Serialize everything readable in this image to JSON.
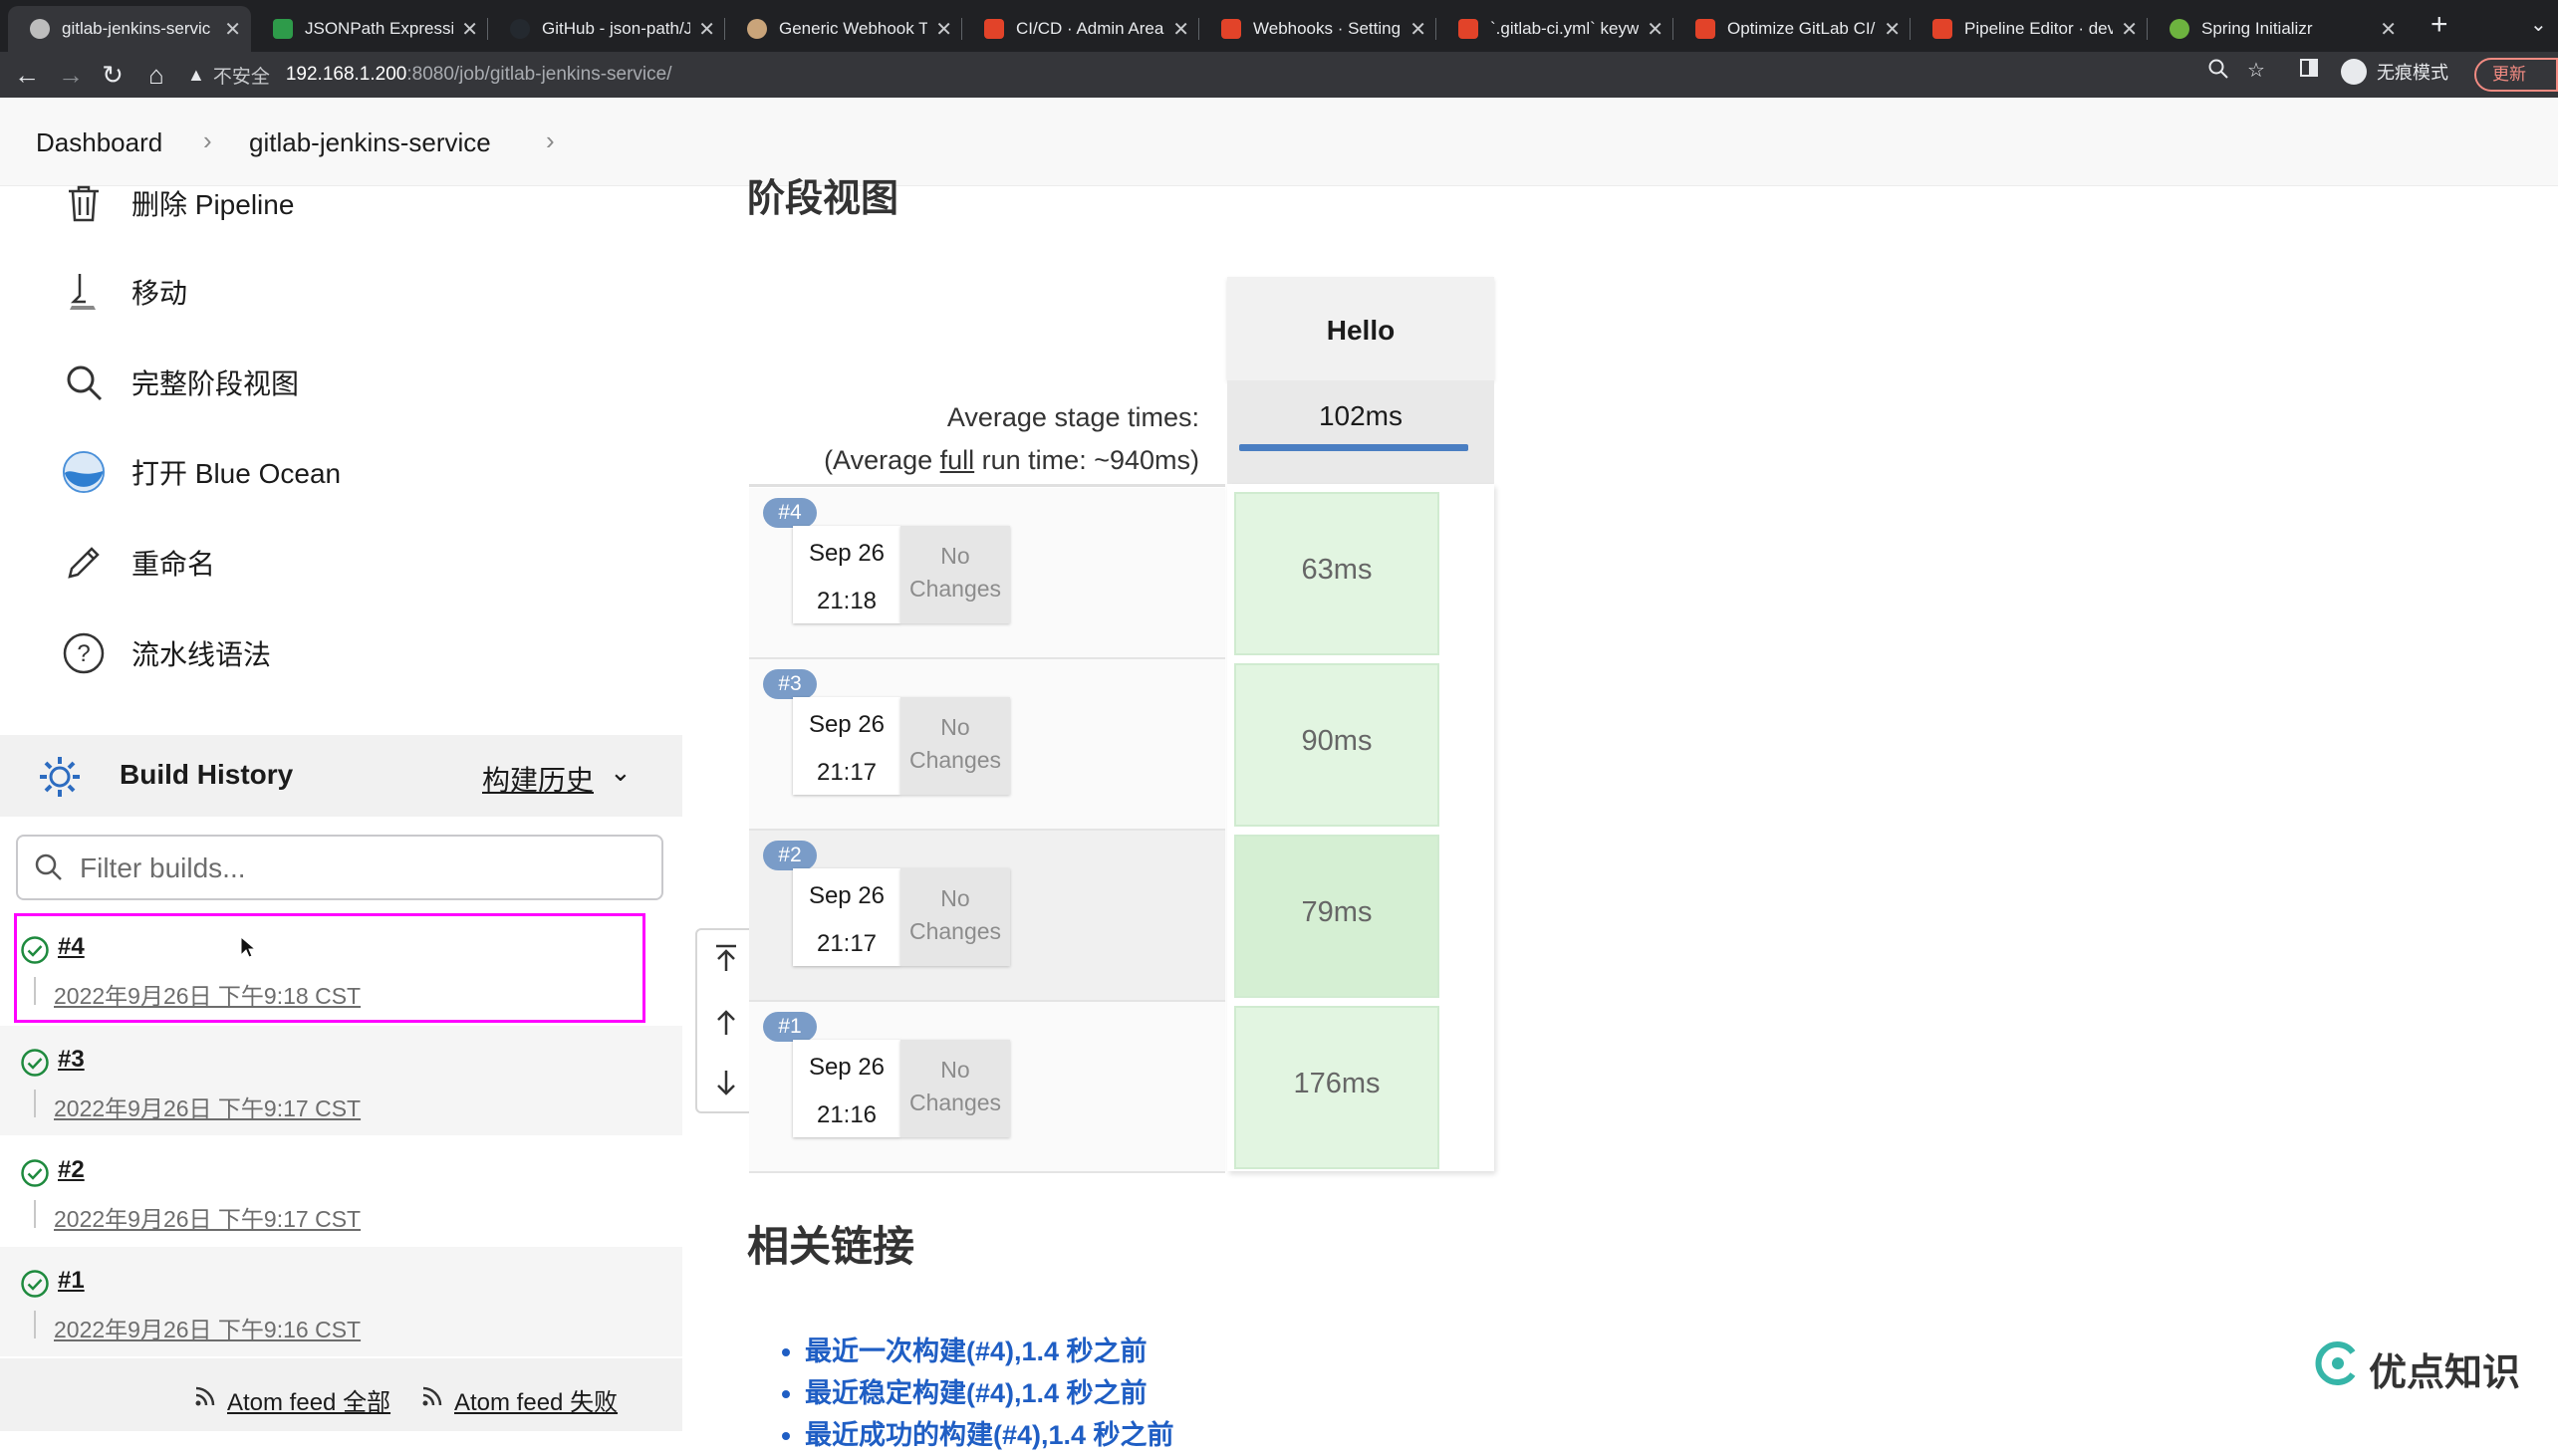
{
  "browser": {
    "tabs": [
      {
        "label": "gitlab-jenkins-servic",
        "icon_color": "#bdbdbd",
        "active": true
      },
      {
        "label": "JSONPath Expressic",
        "icon_color": "#2e9b4a"
      },
      {
        "label": "GitHub - json-path/J",
        "icon_color": "#24292f"
      },
      {
        "label": "Generic Webhook Tr",
        "icon_color": "#c9a47a"
      },
      {
        "label": "CI/CD · Admin Area",
        "icon_color": "#e24329"
      },
      {
        "label": "Webhooks · Setting",
        "icon_color": "#e24329"
      },
      {
        "label": "`.gitlab-ci.yml` keyw",
        "icon_color": "#e24329"
      },
      {
        "label": "Optimize GitLab CI/C",
        "icon_color": "#e24329"
      },
      {
        "label": "Pipeline Editor · dev",
        "icon_color": "#e24329"
      },
      {
        "label": "Spring Initializr",
        "icon_color": "#6db33f"
      }
    ],
    "new_tab": "+",
    "insecure_label": "不安全",
    "url_host": "192.168.1.200",
    "url_path": ":8080/job/gitlab-jenkins-service/",
    "incognito_label": "无痕模式",
    "update_label": "更新"
  },
  "breadcrumbs": {
    "home": "Dashboard",
    "job": "gitlab-jenkins-service"
  },
  "sidebar": {
    "items": [
      {
        "label": "删除 Pipeline",
        "icon": "trash-icon"
      },
      {
        "label": "移动",
        "icon": "move-icon"
      },
      {
        "label": "完整阶段视图",
        "icon": "search-icon"
      },
      {
        "label": "打开 Blue Ocean",
        "icon": "blue-ocean-icon"
      },
      {
        "label": "重命名",
        "icon": "pencil-icon"
      },
      {
        "label": "流水线语法",
        "icon": "help-icon"
      }
    ],
    "build_history": {
      "title": "Build History",
      "trend_label": "构建历史"
    },
    "filter_placeholder": "Filter builds...",
    "builds": [
      {
        "number": "#4",
        "date": "2022年9月26日 下午9:18 CST",
        "status": "success"
      },
      {
        "number": "#3",
        "date": "2022年9月26日 下午9:17 CST",
        "status": "success"
      },
      {
        "number": "#2",
        "date": "2022年9月26日 下午9:17 CST",
        "status": "success"
      },
      {
        "number": "#1",
        "date": "2022年9月26日 下午9:16 CST",
        "status": "success"
      }
    ],
    "feeds": {
      "all": "Atom feed 全部",
      "failed": "Atom feed 失败"
    }
  },
  "stage_view": {
    "title": "阶段视图",
    "stage_name": "Hello",
    "avg_label": "Average stage times:",
    "avg_full_prefix": "(Average ",
    "avg_full_word": "full",
    "avg_full_suffix": " run time: ~940ms)",
    "avg_time": "102ms",
    "runs": [
      {
        "badge": "#4",
        "date": "Sep 26",
        "time": "21:18",
        "changes_line1": "No",
        "changes_line2": "Changes",
        "duration": "63ms"
      },
      {
        "badge": "#3",
        "date": "Sep 26",
        "time": "21:17",
        "changes_line1": "No",
        "changes_line2": "Changes",
        "duration": "90ms"
      },
      {
        "badge": "#2",
        "date": "Sep 26",
        "time": "21:17",
        "changes_line1": "No",
        "changes_line2": "Changes",
        "duration": "79ms"
      },
      {
        "badge": "#1",
        "date": "Sep 26",
        "time": "21:16",
        "changes_line1": "No",
        "changes_line2": "Changes",
        "duration": "176ms"
      }
    ]
  },
  "related_links": {
    "title": "相关链接",
    "items": [
      "最近一次构建(#4),1.4 秒之前",
      "最近稳定构建(#4),1.4 秒之前",
      "最近成功的构建(#4),1.4 秒之前"
    ]
  },
  "watermark": {
    "text": "优点知识"
  },
  "colors": {
    "success": "#1e8a3e",
    "link": "#1f5ec4",
    "highlight": "#ff00ff",
    "stage_ok": "#e2f5e1"
  }
}
